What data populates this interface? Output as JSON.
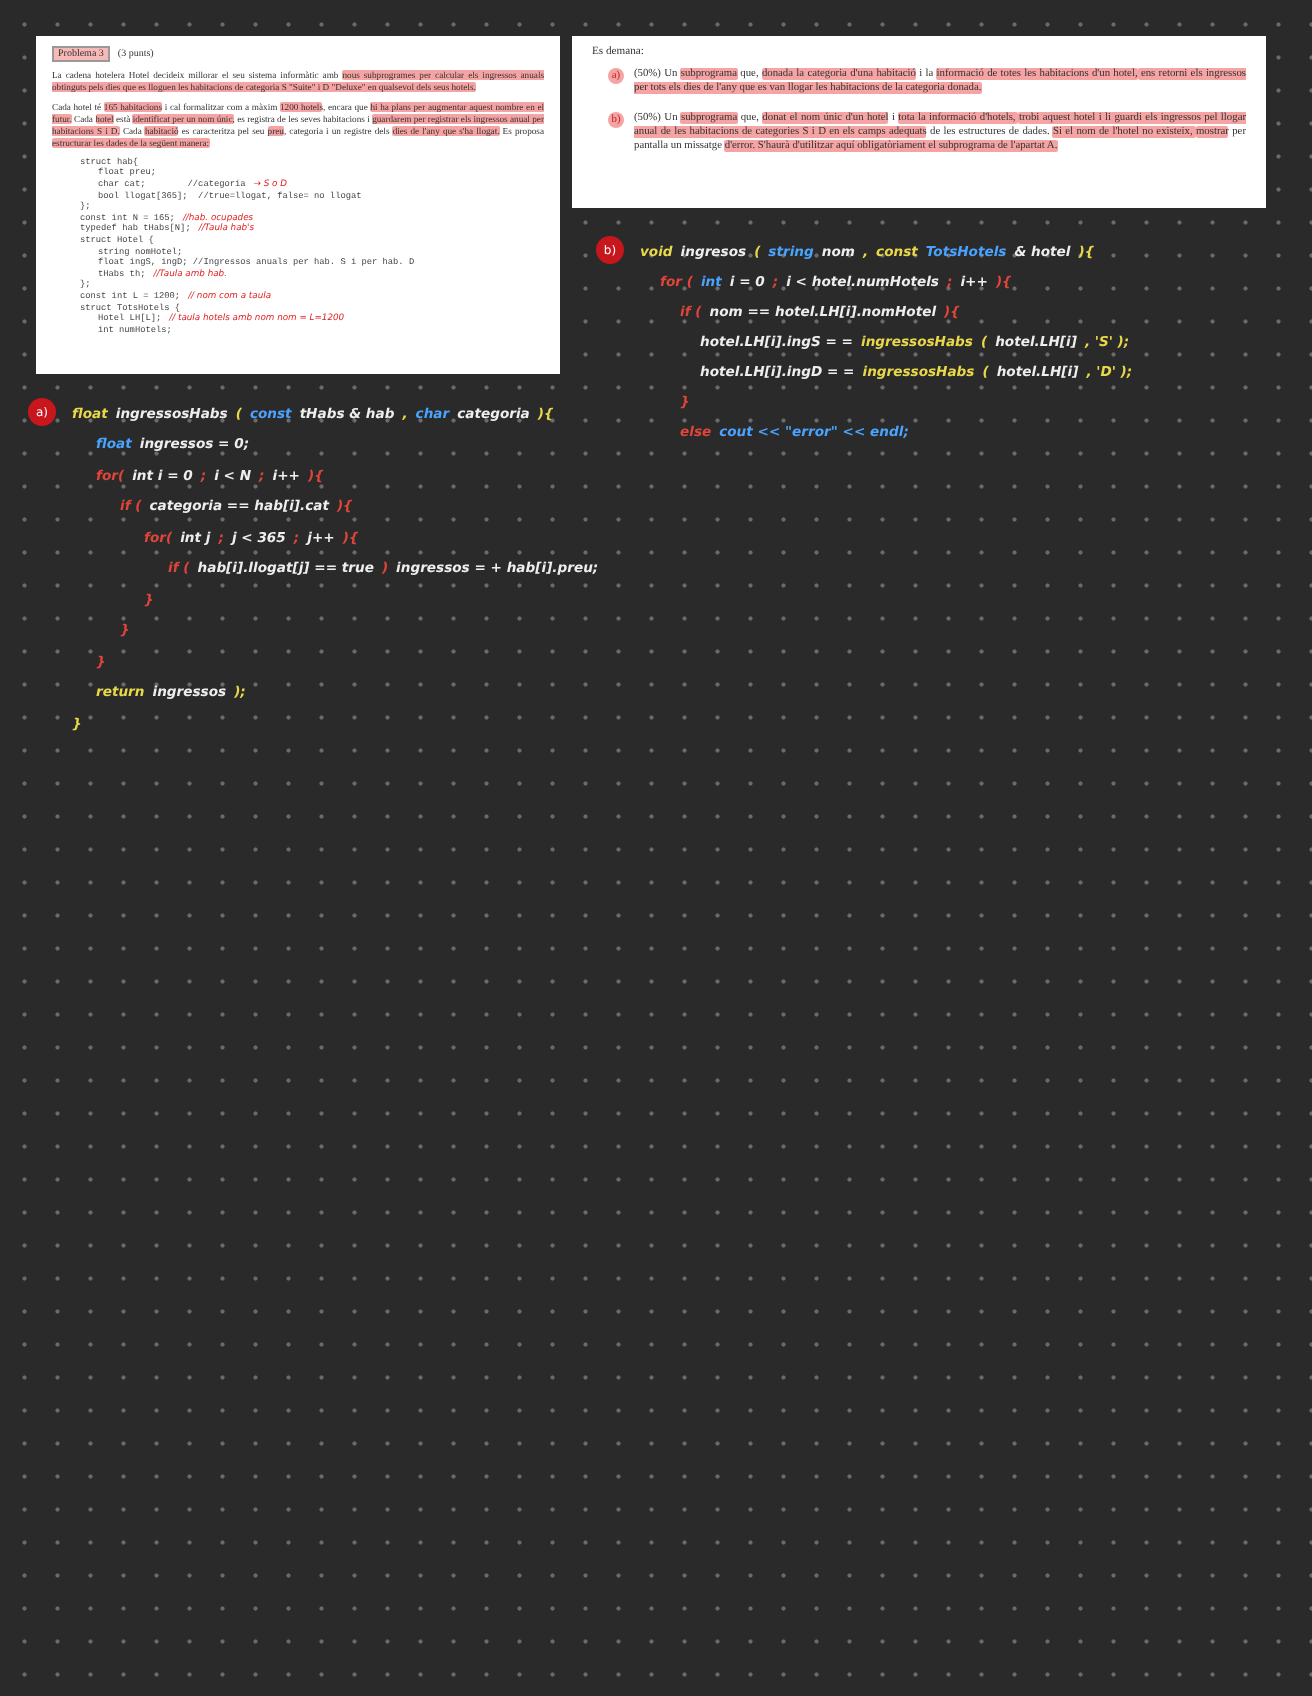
{
  "columns": [
    {
      "sheet": {
        "kind": "problem",
        "title": "Problema 3",
        "points": "(3 punts)",
        "paragraphs": [
          [
            {
              "text": "La cadena hotelera Hotel decideix millorar el seu sistema informàtic amb ",
              "highlighted": false
            },
            {
              "text": "nous subprogrames per calcular els ingressos anuals obtinguts pels dies que es lloguen les habitacions de categoria S \"Suite\" i D \"Deluxe\" en qualsevol dels seus hotels.",
              "highlighted": true
            }
          ],
          [
            {
              "text": "Cada hotel té ",
              "highlighted": false
            },
            {
              "text": "165 habitacions",
              "highlighted": true
            },
            {
              "text": " i cal formalitzar com a màxim ",
              "highlighted": false
            },
            {
              "text": "1200 hotels",
              "highlighted": true
            },
            {
              "text": ", encara que ",
              "highlighted": false
            },
            {
              "text": "hi ha plans per augmentar aquest nombre en el futur.",
              "highlighted": true
            },
            {
              "text": " Cada ",
              "highlighted": false
            },
            {
              "text": "hotel",
              "highlighted": true
            },
            {
              "text": " està ",
              "highlighted": false
            },
            {
              "text": "identificat per un nom únic,",
              "highlighted": true
            },
            {
              "text": " es registra de les seves habitacions i ",
              "highlighted": false
            },
            {
              "text": "guardarem per registrar els ingressos anual per habitacions S i D.",
              "highlighted": true
            },
            {
              "text": " Cada ",
              "highlighted": false
            },
            {
              "text": "habitació",
              "highlighted": true
            },
            {
              "text": " es caracteritza pel seu ",
              "highlighted": false
            },
            {
              "text": "preu",
              "highlighted": true
            },
            {
              "text": ", categoria i un registre dels ",
              "highlighted": false
            },
            {
              "text": "dies de l'any que s'ha llogat.",
              "highlighted": true
            },
            {
              "text": " Es proposa ",
              "highlighted": false
            },
            {
              "text": "estructurar les dades de la següent manera:",
              "highlighted": true
            }
          ]
        ],
        "code": [
          {
            "code": "struct hab{",
            "children": [
              {
                "code": "float preu;"
              },
              {
                "code": "char cat;        //categoria",
                "note": "→ S o D"
              },
              {
                "code": "bool llogat[365];  //true=llogat, false= no llogat"
              }
            ]
          },
          {
            "code": "};"
          },
          {
            "code": "const int N = 165;",
            "note": "//hab. ocupades"
          },
          {
            "code": "typedef hab tHabs[N];",
            "note": "//Taula hab's"
          },
          {
            "code": "struct Hotel {",
            "children": [
              {
                "code": "string nomHotel;"
              },
              {
                "code": "float ingS, ingD; //Ingressos anuals per hab. S i per hab. D"
              },
              {
                "code": "tHabs th;",
                "note": "//Taula amb hab."
              }
            ]
          },
          {
            "code": "};"
          },
          {
            "code": "const int L = 1200;",
            "note": "// nom com a taula"
          },
          {
            "code": "struct TotsHotels {",
            "children": [
              {
                "code": "Hotel LH[L];",
                "note": "// taula hotels amb nom nom = L=1200"
              },
              {
                "code": "int numHotels;"
              }
            ]
          }
        ]
      },
      "answer": {
        "marker": "a)",
        "lines": [
          {
            "tokens": [
              {
                "text": "float",
                "color": "#e8d84a"
              },
              {
                "text": "ingressosHabs",
                "color": "#eeeeee"
              },
              {
                "text": "(",
                "color": "#e8d84a"
              },
              {
                "text": "const",
                "color": "#4aa3ff"
              },
              {
                "text": "tHabs & hab",
                "color": "#eeeeee"
              },
              {
                "text": ",",
                "color": "#e8d84a"
              },
              {
                "text": "char",
                "color": "#4aa3ff"
              },
              {
                "text": "categoria",
                "color": "#eeeeee"
              },
              {
                "text": "){",
                "color": "#e8d84a"
              }
            ],
            "children": [
              {
                "tokens": [
                  {
                    "text": "float",
                    "color": "#4aa3ff"
                  },
                  {
                    "text": "ingressos = 0;",
                    "color": "#eeeeee"
                  }
                ]
              },
              {
                "tokens": [
                  {
                    "text": "for(",
                    "color": "#e0453a"
                  },
                  {
                    "text": "int i = 0",
                    "color": "#eeeeee"
                  },
                  {
                    "text": ";",
                    "color": "#e0453a"
                  },
                  {
                    "text": "i < N",
                    "color": "#eeeeee"
                  },
                  {
                    "text": ";",
                    "color": "#e0453a"
                  },
                  {
                    "text": "i++",
                    "color": "#eeeeee"
                  },
                  {
                    "text": "){",
                    "color": "#e0453a"
                  }
                ],
                "children": [
                  {
                    "tokens": [
                      {
                        "text": "if (",
                        "color": "#e0453a"
                      },
                      {
                        "text": "categoria == hab[i].cat",
                        "color": "#eeeeee"
                      },
                      {
                        "text": "){",
                        "color": "#e0453a"
                      }
                    ],
                    "children": [
                      {
                        "tokens": [
                          {
                            "text": "for(",
                            "color": "#e0453a"
                          },
                          {
                            "text": "int j",
                            "color": "#eeeeee"
                          },
                          {
                            "text": ";",
                            "color": "#e0453a"
                          },
                          {
                            "text": "j < 365",
                            "color": "#eeeeee"
                          },
                          {
                            "text": ";",
                            "color": "#e0453a"
                          },
                          {
                            "text": "j++",
                            "color": "#eeeeee"
                          },
                          {
                            "text": "){",
                            "color": "#e0453a"
                          }
                        ],
                        "children": [
                          {
                            "tokens": [
                              {
                                "text": "if (",
                                "color": "#e0453a"
                              },
                              {
                                "text": "hab[i].llogat[j] == true",
                                "color": "#eeeeee"
                              },
                              {
                                "text": ")",
                                "color": "#e0453a"
                              },
                              {
                                "text": "ingressos = + hab[i].preu;",
                                "color": "#eeeeee"
                              }
                            ]
                          }
                        ]
                      },
                      {
                        "tokens": [
                          {
                            "text": "}",
                            "color": "#e0453a"
                          }
                        ]
                      }
                    ]
                  },
                  {
                    "tokens": [
                      {
                        "text": "}",
                        "color": "#e0453a"
                      }
                    ]
                  }
                ]
              },
              {
                "tokens": [
                  {
                    "text": "}",
                    "color": "#e0453a"
                  }
                ]
              },
              {
                "tokens": [
                  {
                    "text": "return",
                    "color": "#e8d84a"
                  },
                  {
                    "text": "ingressos",
                    "color": "#eeeeee"
                  },
                  {
                    "text": ");",
                    "color": "#e8d84a"
                  }
                ]
              }
            ]
          },
          {
            "tokens": [
              {
                "text": "}",
                "color": "#e8d84a"
              }
            ]
          }
        ]
      }
    },
    {
      "sheet": {
        "kind": "request",
        "intro": "Es demana:",
        "items": [
          {
            "marker": "a)",
            "segments": [
              {
                "text": "(50%) Un ",
                "highlighted": false
              },
              {
                "text": "subprograma",
                "highlighted": true
              },
              {
                "text": " que, ",
                "highlighted": false
              },
              {
                "text": "donada la categoria d'una habitació",
                "highlighted": true
              },
              {
                "text": " i la ",
                "highlighted": false
              },
              {
                "text": "informació de totes les habitacions d'un hotel,",
                "highlighted": true
              },
              {
                "text": " ens retorni els ingressos per tots els dies de l'any que es van llogar les habitacions de la categoria donada.",
                "highlighted": true
              }
            ]
          },
          {
            "marker": "b)",
            "segments": [
              {
                "text": "(50%) Un ",
                "highlighted": false
              },
              {
                "text": "subprograma",
                "highlighted": true
              },
              {
                "text": " que, ",
                "highlighted": false
              },
              {
                "text": "donat el nom únic d'un hotel",
                "highlighted": true
              },
              {
                "text": " i ",
                "highlighted": false
              },
              {
                "text": "tota la informació d'hotels, ",
                "highlighted": true
              },
              {
                "text": "trobi aquest hotel i li guardi els ingressos pel llogar anual de les habitacions de categories S i D en els camps adequats",
                "highlighted": true
              },
              {
                "text": " de les estructures de dades. ",
                "highlighted": false
              },
              {
                "text": "Si el nom de l'hotel no existeix, ",
                "highlighted": true
              },
              {
                "text": "mostrar",
                "highlighted": true
              },
              {
                "text": " per pantalla un missatge ",
                "highlighted": false
              },
              {
                "text": "d'error. S'haurà d'utilitzar aquí obligatòriament el subprograma de l'apartat A.",
                "highlighted": true
              }
            ]
          }
        ]
      },
      "answer": {
        "marker": "b)",
        "lines": [
          {
            "tokens": [
              {
                "text": "void",
                "color": "#e8d84a"
              },
              {
                "text": "ingresos",
                "color": "#eeeeee"
              },
              {
                "text": "(",
                "color": "#e8d84a"
              },
              {
                "text": "string",
                "color": "#4aa3ff"
              },
              {
                "text": "nom",
                "color": "#eeeeee"
              },
              {
                "text": ",",
                "color": "#e8d84a"
              },
              {
                "text": "const",
                "color": "#e8d84a"
              },
              {
                "text": "TotsHotels",
                "color": "#4aa3ff"
              },
              {
                "text": "& hotel",
                "color": "#eeeeee"
              },
              {
                "text": "){",
                "color": "#e8d84a"
              }
            ],
            "children": [
              {
                "tokens": [
                  {
                    "text": "for (",
                    "color": "#e0453a"
                  },
                  {
                    "text": "int",
                    "color": "#4aa3ff"
                  },
                  {
                    "text": "i = 0",
                    "color": "#eeeeee"
                  },
                  {
                    "text": ";",
                    "color": "#e0453a"
                  },
                  {
                    "text": "i < hotel.numHotels",
                    "color": "#eeeeee"
                  },
                  {
                    "text": ";",
                    "color": "#e0453a"
                  },
                  {
                    "text": "i++",
                    "color": "#eeeeee"
                  },
                  {
                    "text": "){",
                    "color": "#e0453a"
                  }
                ],
                "children": [
                  {
                    "tokens": [
                      {
                        "text": "if (",
                        "color": "#e0453a"
                      },
                      {
                        "text": "nom == hotel.LH[i].nomHotel",
                        "color": "#eeeeee"
                      },
                      {
                        "text": "){",
                        "color": "#e0453a"
                      }
                    ],
                    "children": [
                      {
                        "tokens": [
                          {
                            "text": "hotel.LH[i].ingS = =",
                            "color": "#eeeeee"
                          },
                          {
                            "text": "ingressosHabs",
                            "color": "#e8d84a"
                          },
                          {
                            "text": "(",
                            "color": "#e8d84a"
                          },
                          {
                            "text": "hotel.LH[i]",
                            "color": "#eeeeee"
                          },
                          {
                            "text": ", 'S' );",
                            "color": "#e8d84a"
                          }
                        ]
                      },
                      {
                        "tokens": [
                          {
                            "text": "hotel.LH[i].ingD = =",
                            "color": "#eeeeee"
                          },
                          {
                            "text": "ingressosHabs",
                            "color": "#e8d84a"
                          },
                          {
                            "text": "(",
                            "color": "#e8d84a"
                          },
                          {
                            "text": "hotel.LH[i]",
                            "color": "#eeeeee"
                          },
                          {
                            "text": ", 'D' );",
                            "color": "#e8d84a"
                          }
                        ]
                      }
                    ]
                  },
                  {
                    "tokens": [
                      {
                        "text": "}",
                        "color": "#e0453a"
                      }
                    ]
                  },
                  {
                    "tokens": [
                      {
                        "text": "else",
                        "color": "#e0453a"
                      },
                      {
                        "text": "cout << \"error\" << endl;",
                        "color": "#4aa3ff"
                      }
                    ]
                  }
                ]
              }
            ]
          }
        ]
      }
    }
  ]
}
